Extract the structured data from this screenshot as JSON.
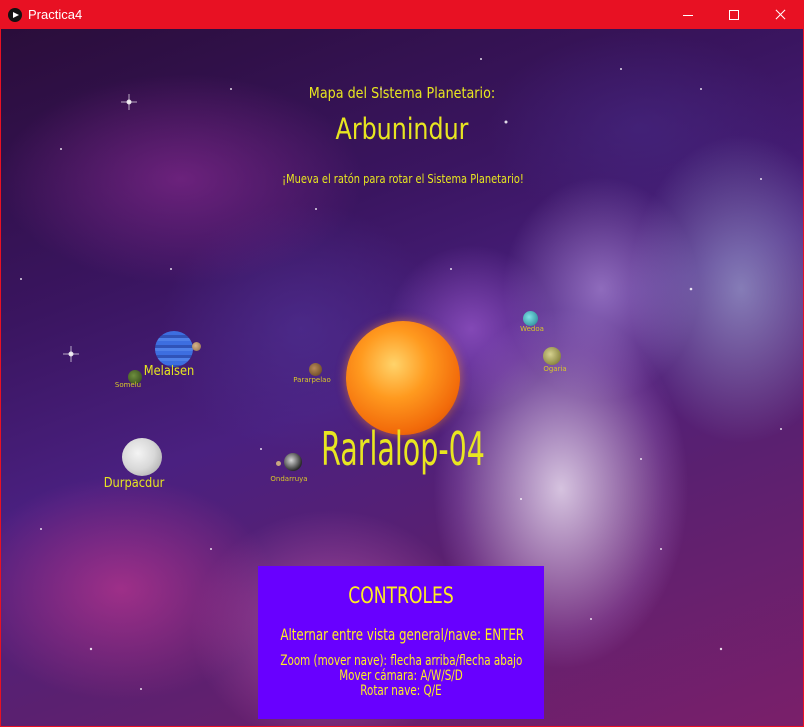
{
  "window": {
    "title": "Practica4"
  },
  "map": {
    "subtitle": "Mapa del Sistema Planetario:",
    "system_name": "Arbunindur",
    "hint": "¡Mueva el ratón para rotar el Sistema Planetario!",
    "star_name": "Rarlalop-04"
  },
  "planets": {
    "melalsen": "Melalsen",
    "durpacdur": "Durpacdur",
    "ondarruya": "Ondarruya",
    "small_a": "Somelu",
    "small_teal": "Wedoa",
    "small_ochre": "Ogaria",
    "small_brown": "Pararpelao"
  },
  "controls": {
    "title": "CONTROLES",
    "toggle_view": "Alternar entre vista general/nave: ENTER",
    "zoom": "Zoom (mover nave): flecha arriba/flecha abajo",
    "move_camera": "Mover cámara: A/W/S/D",
    "rotate_ship": "Rotar nave: Q/E"
  },
  "colors": {
    "titlebar": "#e81123",
    "text_yellow": "#e8e620",
    "controls_bg": "#6800ff",
    "controls_text": "#ffee22"
  },
  "icons": [
    "processing-app-icon",
    "minimize-icon",
    "maximize-icon",
    "close-icon"
  ]
}
